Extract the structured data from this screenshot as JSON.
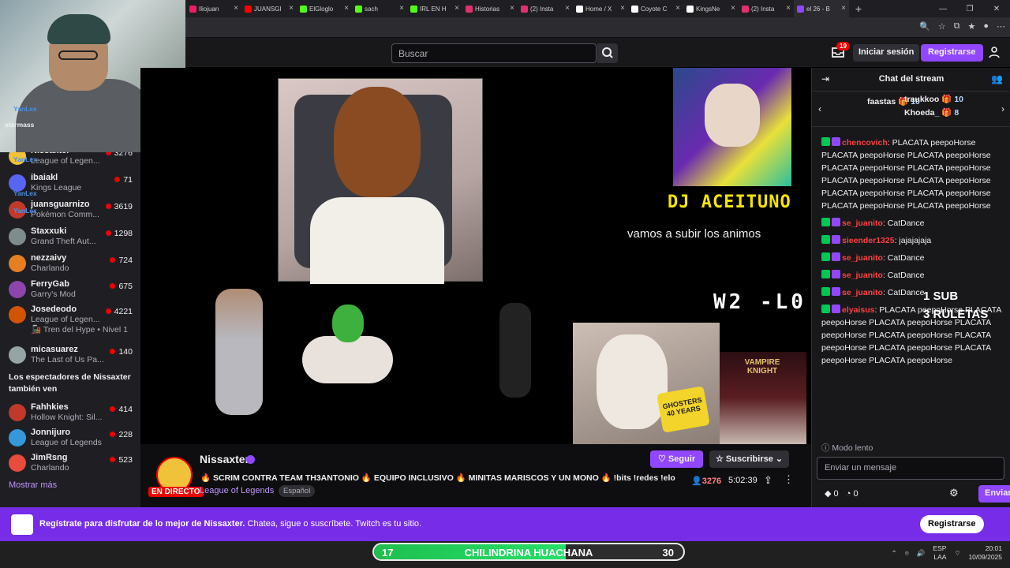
{
  "browser": {
    "tabs": [
      {
        "label": "Iliojuan",
        "color": "#e91e63"
      },
      {
        "label": "JUANSGI",
        "color": "#ff0000"
      },
      {
        "label": "ElGloglo",
        "color": "#53fc18"
      },
      {
        "label": "sach",
        "color": "#53fc18"
      },
      {
        "label": "IRL EN H",
        "color": "#53fc18"
      },
      {
        "label": "Historias",
        "color": "#e1306c"
      },
      {
        "label": "(2) Insta",
        "color": "#e1306c"
      },
      {
        "label": "Home / X",
        "color": "#ffffff"
      },
      {
        "label": "Coyote C",
        "color": "#ffffff"
      },
      {
        "label": "KingsNe",
        "color": "#ffffff"
      },
      {
        "label": "(2) Insta",
        "color": "#e1306c"
      },
      {
        "label": "el 26 - B",
        "color": "#9147ff"
      }
    ]
  },
  "nav": {
    "search_placeholder": "Buscar",
    "notif_count": "19",
    "login": "Iniciar sesión",
    "register": "Registrarse"
  },
  "sidebar": {
    "channels": [
      {
        "name": "Nissaxter",
        "game": "League of Legen...",
        "viewers": "3276",
        "color": "#f0c23a"
      },
      {
        "name": "ibaiakl",
        "game": "Kings League",
        "viewers": "71",
        "color": "#5865f2"
      },
      {
        "name": "juansguarnizo",
        "game": "Pokémon Comm...",
        "viewers": "3619",
        "color": "#c0392b"
      },
      {
        "name": "Staxxuki",
        "game": "Grand Theft Aut...",
        "viewers": "1298",
        "color": "#7f8c8d"
      },
      {
        "name": "nezzaivy",
        "game": "Charlando",
        "viewers": "724",
        "color": "#e67e22"
      },
      {
        "name": "FerryGab",
        "game": "Garry's Mod",
        "viewers": "675",
        "color": "#8e44ad"
      },
      {
        "name": "Josedeodo",
        "game": "League of Legen...",
        "viewers": "4221",
        "color": "#d35400",
        "extra": "Tren del Hype • Nivel 1"
      },
      {
        "name": "micasuarez",
        "game": "The Last of Us Pa...",
        "viewers": "140",
        "color": "#95a5a6"
      }
    ],
    "also_watch": "Los espectadores de Nissaxter también ven",
    "recommended": [
      {
        "name": "Fahhkies",
        "game": "Hollow Knight: Sil...",
        "viewers": "414",
        "color": "#c0392b"
      },
      {
        "name": "Jonnijuro",
        "game": "League of Legends",
        "viewers": "228",
        "color": "#3498db"
      },
      {
        "name": "JimRsng",
        "game": "Charlando",
        "viewers": "523",
        "color": "#e74c3c"
      }
    ],
    "show_more": "Mostrar más",
    "overlay_tags": [
      "YanLex",
      "starmass"
    ]
  },
  "video": {
    "dj_title": "DJ ACEITUNO",
    "dj_sub": "vamos a subir los animos",
    "score": "W2 -L0",
    "ghost": "GHOSTERS 40 YEARS",
    "vampire": "VAMPIRE KNIGHT"
  },
  "overlay": {
    "sub_line1": "1 SUB",
    "sub_line2": "3 RULETAS"
  },
  "stream": {
    "live": "EN DIRECTO",
    "streamer": "Nissaxter",
    "title": "🔥 SCRIM CONTRA TEAM TH3ANTONIO 🔥 EQUIPO INCLUSIVO 🔥 MINITAS MARISCOS Y UN MONO 🔥 !bits !redes !elo",
    "game": "League of Legends",
    "tag": "Español",
    "follow": "Seguir",
    "subscribe": "Suscribirse",
    "viewers": "3276",
    "uptime": "5:02:39"
  },
  "chat": {
    "header": "Chat del stream",
    "gifters": [
      {
        "name": "faastas",
        "count": "10"
      },
      {
        "name": "traukkoo",
        "count": "10"
      },
      {
        "name": "Khoeda_",
        "count": "8"
      }
    ],
    "messages": [
      {
        "user": "chencovich",
        "color": "#ff4040",
        "text": "PLACATA peepoHorse PLACATA peepoHorse PLACATA peepoHorse PLACATA peepoHorse PLACATA peepoHorse PLACATA peepoHorse PLACATA peepoHorse PLACATA peepoHorse PLACATA peepoHorse PLACATA peepoHorse PLACATA peepoHorse"
      },
      {
        "user": "se_juanito",
        "color": "#ff4040",
        "text": "CatDance"
      },
      {
        "user": "sieender1325",
        "color": "#ff4040",
        "text": "jajajajaja"
      },
      {
        "user": "se_juanito",
        "color": "#ff4040",
        "text": "CatDance"
      },
      {
        "user": "se_juanito",
        "color": "#ff4040",
        "text": "CatDance"
      },
      {
        "user": "se_juanito",
        "color": "#ff4040",
        "text": "CatDance"
      },
      {
        "user": "elyaisus",
        "color": "#ff4040",
        "text": "PLACATA peepoHorse PLACATA peepoHorse PLACATA peepoHorse PLACATA peepoHorse PLACATA peepoHorse PLACATA peepoHorse PLACATA peepoHorse PLACATA peepoHorse PLACATA peepoHorse"
      }
    ],
    "slow_mode": "Modo lento",
    "input_placeholder": "Enviar un mensaje",
    "points_a": "0",
    "points_b": "0",
    "send": "Enviar"
  },
  "banner": {
    "bold": "Regístrate para disfrutar de lo mejor de Nissaxter.",
    "rest": " Chatea, sigue o suscríbete. Twitch es tu sitio.",
    "button": "Registrarse"
  },
  "taskbar": {
    "bar_left": "17",
    "bar_center": "CHILINDRINA HUACHANA",
    "bar_right": "30",
    "bar_fill": 0.62,
    "lang1": "ESP",
    "lang2": "LAA",
    "time": "20:01",
    "date": "10/09/2025"
  }
}
